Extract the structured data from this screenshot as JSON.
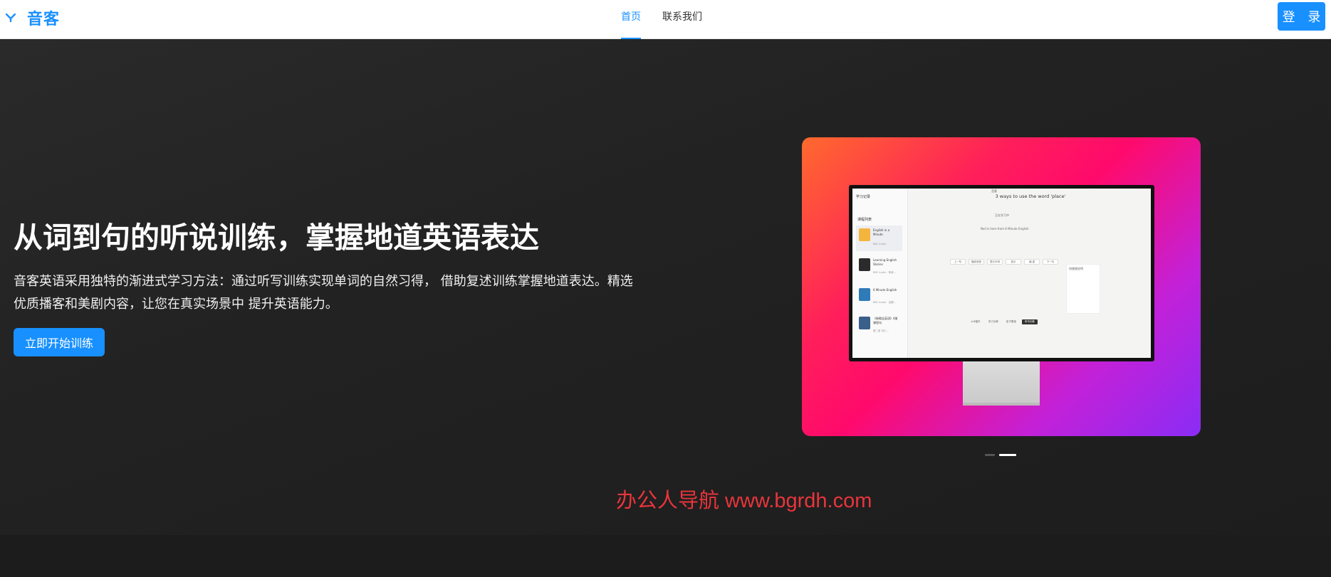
{
  "header": {
    "brand": "音客",
    "logo_icon": "y-logo-icon",
    "nav": [
      {
        "label": "首页",
        "active": true
      },
      {
        "label": "联系我们",
        "active": false
      }
    ],
    "login_label": "登 录"
  },
  "hero": {
    "title": "从词到句的听说训练，掌握地道英语表达",
    "description": "音客英语采用独特的渐进式学习方法：通过听写训练实现单词的自然习得， 借助复述训练掌握地道表达。精选优质播客和美剧内容，让您在真实场景中 提升英语能力。",
    "cta_label": "立即开始训练",
    "carousel": {
      "slides": 2,
      "active_index": 1
    }
  },
  "preview": {
    "app_title": "音客",
    "sidebar_title": "学习记录",
    "sidebar_list_title": "课程列表",
    "courses": [
      {
        "title": "English in a Minute",
        "sub": "BBC Audio"
      },
      {
        "title": "Learning English Stories",
        "sub": "BBC Audio · 故事..."
      },
      {
        "title": "6 Minute English",
        "sub": "BBC Audio · 话题..."
      },
      {
        "title": "《新概念英语》4册 课程句",
        "sub": "第二册 词汇..."
      }
    ],
    "lesson_title": "3 ways to use the word 'place'",
    "lesson_sub": "正在学习中",
    "lesson_line": "Neil is here from 6 Minute English",
    "controls": [
      "上一句",
      "播放语音",
      "提示字母",
      "显示",
      "偏 重",
      "下一句"
    ],
    "bottom_controls": [
      "A-B循环",
      "听力训练",
      "影子跟读",
      "听写训练"
    ],
    "side_panel_title": "快捷键说明"
  },
  "watermark": "办公人导航 www.bgrdh.com",
  "colors": {
    "accent": "#1890ff",
    "background": "#1f1f1f",
    "watermark": "#e8353b",
    "gradient_start": "#ff6a2d",
    "gradient_mid": "#ff0a6c",
    "gradient_end": "#8a2cf5"
  }
}
